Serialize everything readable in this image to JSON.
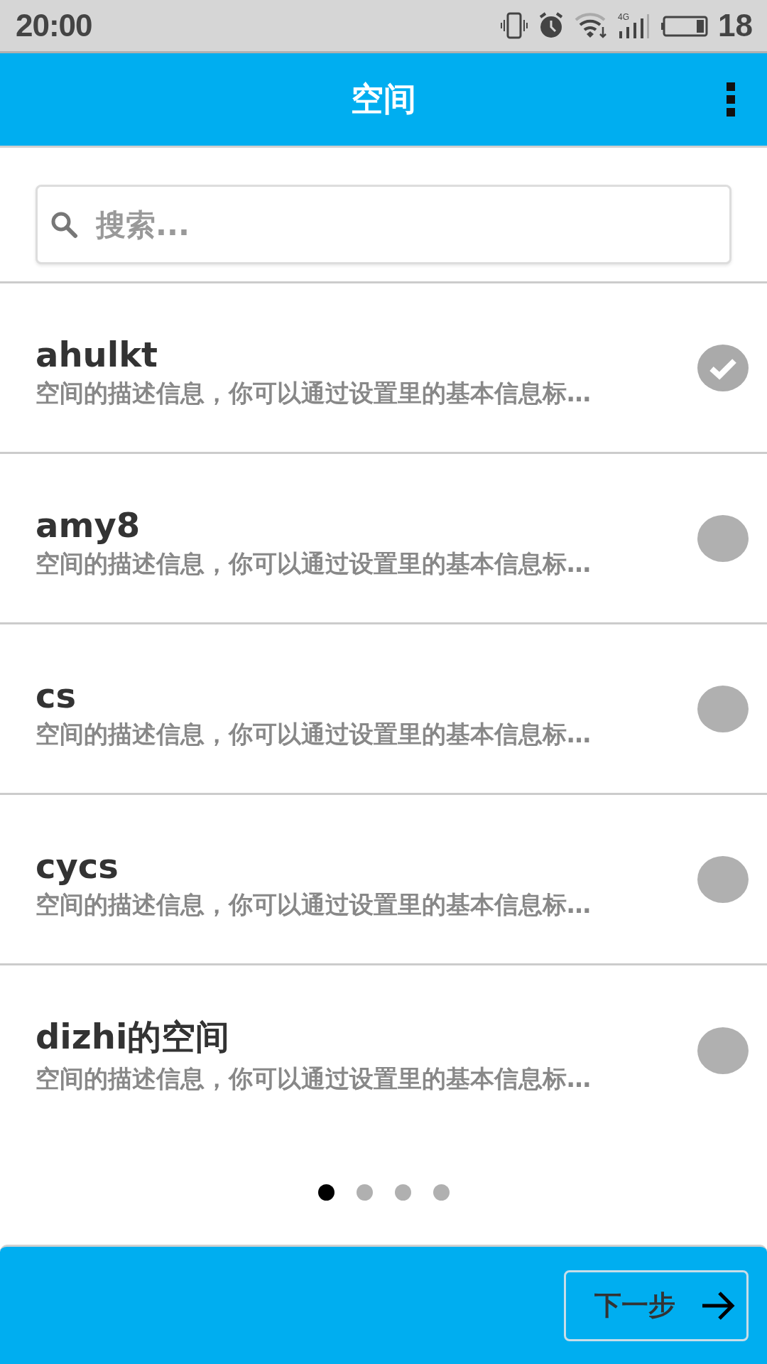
{
  "status_bar": {
    "time": "20:00",
    "network_type": "4G",
    "battery": "18"
  },
  "header": {
    "title": "空间"
  },
  "search": {
    "placeholder": "搜索..."
  },
  "spaces": [
    {
      "name": "ahulkt",
      "description": "空间的描述信息，你可以通过设置里的基本信息标…",
      "selected": true
    },
    {
      "name": "amy8",
      "description": "空间的描述信息，你可以通过设置里的基本信息标…",
      "selected": false
    },
    {
      "name": "cs",
      "description": "空间的描述信息，你可以通过设置里的基本信息标…",
      "selected": false
    },
    {
      "name": "cycs",
      "description": "空间的描述信息，你可以通过设置里的基本信息标…",
      "selected": false
    },
    {
      "name": "dizhi的空间",
      "description": "空间的描述信息，你可以通过设置里的基本信息标…",
      "selected": false
    }
  ],
  "pages": [
    {
      "selected": true
    },
    {
      "selected": false
    },
    {
      "selected": false
    },
    {
      "selected": false
    }
  ],
  "footer": {
    "next_button": "下一步"
  }
}
